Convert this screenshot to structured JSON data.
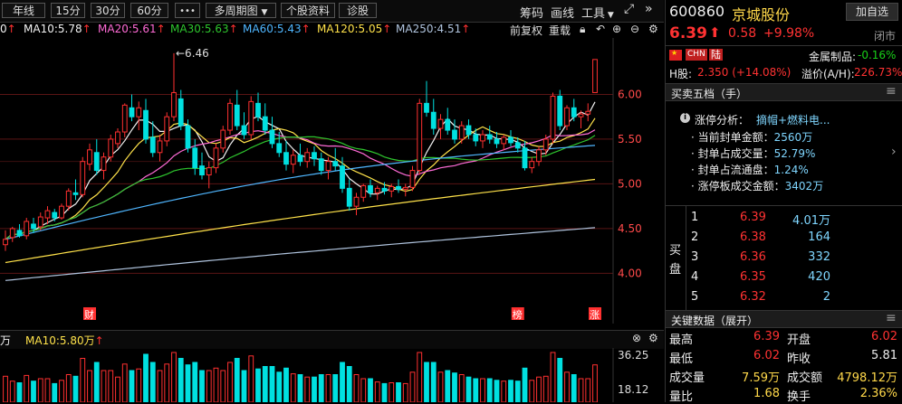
{
  "toolbar": {
    "periods": [
      "年线",
      "15分",
      "30分",
      "60分"
    ],
    "more": "•••",
    "multi_period": "多周期图",
    "stock_info": "个股资料",
    "diagnose": "诊股",
    "chips": "筹码",
    "draw": "画线",
    "tools": "工具"
  },
  "ma_line": {
    "lead": "0",
    "items": [
      {
        "text": "MA10:5.78",
        "color": "#f2f2f2"
      },
      {
        "text": "MA20:5.61",
        "color": "#ff6bd6"
      },
      {
        "text": "MA30:5.63",
        "color": "#2ec62e"
      },
      {
        "text": "MA60:5.43",
        "color": "#4fb6ff"
      },
      {
        "text": "MA120:5.05",
        "color": "#ffe24a"
      },
      {
        "text": "MA250:4.51",
        "color": "#b0c4de"
      }
    ],
    "arrow": "↑",
    "adjust": "前复权",
    "overlay": "重载"
  },
  "chart_data": {
    "type": "candlestick",
    "y_ticks": [
      "6.00",
      "5.50",
      "5.00",
      "4.50",
      "4.00"
    ],
    "ylim": [
      3.6,
      6.55
    ],
    "max_annotation": "←6.46",
    "markers": [
      {
        "label": "财",
        "color": "#ff3030"
      },
      {
        "label": "榜",
        "color": "#ff3030"
      },
      {
        "label": "涨",
        "color": "#ff3030"
      }
    ],
    "candles": [
      [
        4.32,
        4.48,
        4.25,
        4.38
      ],
      [
        4.4,
        4.52,
        4.35,
        4.5
      ],
      [
        4.48,
        4.55,
        4.4,
        4.42
      ],
      [
        4.42,
        4.62,
        4.38,
        4.58
      ],
      [
        4.55,
        4.62,
        4.45,
        4.5
      ],
      [
        4.52,
        4.68,
        4.48,
        4.63
      ],
      [
        4.62,
        4.75,
        4.55,
        4.7
      ],
      [
        4.68,
        4.72,
        4.58,
        4.62
      ],
      [
        4.62,
        4.78,
        4.6,
        4.75
      ],
      [
        4.75,
        4.95,
        4.7,
        4.92
      ],
      [
        4.9,
        5.05,
        4.82,
        4.88
      ],
      [
        4.88,
        5.3,
        4.85,
        5.25
      ],
      [
        5.22,
        5.45,
        5.15,
        5.38
      ],
      [
        5.35,
        5.5,
        5.1,
        5.15
      ],
      [
        5.15,
        5.35,
        5.05,
        5.3
      ],
      [
        5.3,
        5.55,
        5.25,
        5.5
      ],
      [
        5.45,
        5.62,
        5.4,
        5.58
      ],
      [
        5.58,
        5.9,
        5.52,
        5.88
      ],
      [
        5.85,
        6.0,
        5.7,
        5.75
      ],
      [
        5.75,
        5.92,
        5.6,
        5.85
      ],
      [
        5.82,
        5.95,
        5.45,
        5.5
      ],
      [
        5.52,
        5.7,
        5.3,
        5.35
      ],
      [
        5.35,
        5.55,
        5.25,
        5.48
      ],
      [
        5.48,
        5.8,
        5.42,
        5.75
      ],
      [
        5.75,
        6.46,
        5.7,
        6.02
      ],
      [
        5.95,
        6.05,
        5.6,
        5.65
      ],
      [
        5.65,
        5.72,
        5.35,
        5.4
      ],
      [
        5.4,
        5.5,
        5.1,
        5.18
      ],
      [
        5.2,
        5.35,
        5.05,
        5.1
      ],
      [
        5.1,
        5.25,
        4.95,
        5.18
      ],
      [
        5.18,
        5.45,
        5.12,
        5.4
      ],
      [
        5.4,
        5.65,
        5.35,
        5.6
      ],
      [
        5.6,
        5.95,
        5.55,
        5.9
      ],
      [
        5.88,
        6.05,
        5.6,
        5.65
      ],
      [
        5.65,
        5.8,
        5.5,
        5.55
      ],
      [
        5.55,
        5.98,
        5.5,
        5.92
      ],
      [
        5.9,
        6.02,
        5.7,
        5.75
      ],
      [
        5.75,
        5.9,
        5.55,
        5.6
      ],
      [
        5.6,
        5.75,
        5.4,
        5.45
      ],
      [
        5.45,
        5.58,
        5.3,
        5.35
      ],
      [
        5.35,
        5.48,
        5.15,
        5.22
      ],
      [
        5.22,
        5.38,
        5.12,
        5.32
      ],
      [
        5.32,
        5.45,
        5.2,
        5.25
      ],
      [
        5.25,
        5.4,
        5.18,
        5.35
      ],
      [
        5.35,
        5.42,
        5.2,
        5.28
      ],
      [
        5.28,
        5.35,
        5.1,
        5.15
      ],
      [
        5.15,
        5.3,
        5.05,
        5.25
      ],
      [
        5.25,
        5.4,
        5.15,
        5.2
      ],
      [
        5.2,
        5.3,
        4.9,
        4.95
      ],
      [
        4.95,
        5.05,
        4.7,
        4.75
      ],
      [
        4.75,
        4.9,
        4.65,
        4.85
      ],
      [
        4.85,
        5.0,
        4.8,
        4.98
      ],
      [
        4.98,
        5.05,
        4.85,
        4.9
      ],
      [
        4.9,
        4.98,
        4.82,
        4.95
      ],
      [
        4.95,
        5.02,
        4.88,
        4.92
      ],
      [
        4.92,
        5.0,
        4.85,
        4.97
      ],
      [
        4.97,
        5.05,
        4.9,
        4.94
      ],
      [
        4.94,
        5.0,
        4.86,
        4.96
      ],
      [
        4.96,
        5.2,
        4.92,
        5.15
      ],
      [
        5.15,
        5.95,
        5.1,
        5.9
      ],
      [
        5.9,
        6.15,
        5.75,
        5.8
      ],
      [
        5.8,
        5.95,
        5.55,
        5.62
      ],
      [
        5.62,
        5.78,
        5.5,
        5.72
      ],
      [
        5.72,
        5.85,
        5.55,
        5.6
      ],
      [
        5.6,
        5.72,
        5.45,
        5.5
      ],
      [
        5.5,
        5.7,
        5.45,
        5.65
      ],
      [
        5.65,
        5.72,
        5.5,
        5.55
      ],
      [
        5.55,
        5.62,
        5.42,
        5.48
      ],
      [
        5.48,
        5.6,
        5.4,
        5.55
      ],
      [
        5.55,
        5.65,
        5.45,
        5.5
      ],
      [
        5.5,
        5.58,
        5.4,
        5.45
      ],
      [
        5.45,
        5.55,
        5.38,
        5.52
      ],
      [
        5.52,
        5.6,
        5.42,
        5.46
      ],
      [
        5.46,
        5.52,
        5.35,
        5.4
      ],
      [
        5.4,
        5.48,
        5.15,
        5.18
      ],
      [
        5.18,
        5.3,
        5.12,
        5.25
      ],
      [
        5.25,
        5.42,
        5.2,
        5.38
      ],
      [
        5.38,
        5.55,
        5.32,
        5.5
      ],
      [
        5.5,
        6.02,
        5.45,
        5.98
      ],
      [
        5.98,
        6.05,
        5.6,
        5.65
      ],
      [
        5.65,
        5.88,
        5.6,
        5.85
      ],
      [
        5.85,
        5.95,
        5.7,
        5.75
      ],
      [
        5.75,
        5.82,
        5.62,
        5.78
      ],
      [
        5.78,
        5.9,
        5.7,
        5.81
      ],
      [
        6.02,
        6.39,
        6.02,
        6.39
      ]
    ],
    "ma_colors": [
      "#f2f2f2",
      "#ffe24a",
      "#ff6bd6",
      "#2ec62e",
      "#4fb6ff",
      "#ffe24a",
      "#b0c4de"
    ],
    "volume_ticks": [
      "36.25",
      "18.12"
    ],
    "volume_header": "MA10:5.80万",
    "volume_lead": "万"
  },
  "stock": {
    "code": "600860",
    "name": "京城股份",
    "add_watch": "加自选",
    "price": "6.39",
    "arrow": "⬆",
    "change": "0.58",
    "pct": "+9.98%",
    "status": "闭市",
    "flags": [
      "CHN",
      "陆"
    ],
    "sector": "金属制品",
    "sector_change": "-0.16%",
    "h_label": "H股",
    "h_price": "2.350",
    "h_change": "(+14.08%)",
    "premium_label": "溢价(A/H)",
    "premium": "226.73%"
  },
  "order_book": {
    "title": "买卖五档（手）",
    "limit_title": "涨停分析：",
    "limit_tag": "摘帽+燃料电...",
    "rows": [
      {
        "k": "当前封单金额：",
        "v": "2560万"
      },
      {
        "k": "封单占成交量：",
        "v": "52.79%"
      },
      {
        "k": "封单占流通盘：",
        "v": "1.24%"
      },
      {
        "k": "涨停板成交金额：",
        "v": "3402万"
      }
    ],
    "buy_label": [
      "买",
      "盘"
    ],
    "bids": [
      {
        "n": "1",
        "p": "6.39",
        "v": "4.01万"
      },
      {
        "n": "2",
        "p": "6.38",
        "v": "164"
      },
      {
        "n": "3",
        "p": "6.36",
        "v": "332"
      },
      {
        "n": "4",
        "p": "6.35",
        "v": "420"
      },
      {
        "n": "5",
        "p": "6.32",
        "v": "2"
      }
    ]
  },
  "key_data": {
    "title": "关键数据（展开）",
    "rows": [
      {
        "l1": "最高",
        "v1": "6.39",
        "c1": "red",
        "l2": "开盘",
        "v2": "6.02",
        "c2": "red"
      },
      {
        "l1": "最低",
        "v1": "6.02",
        "c1": "red",
        "l2": "昨收",
        "v2": "5.81",
        "c2": "white"
      },
      {
        "l1": "成交量",
        "v1": "7.59万",
        "c1": "yellow",
        "l2": "成交额",
        "v2": "4798.12万",
        "c2": "yellow"
      },
      {
        "l1": "量比",
        "v1": "1.68",
        "c1": "yellow",
        "l2": "换手",
        "v2": "2.36%",
        "c2": "yellow"
      }
    ]
  }
}
